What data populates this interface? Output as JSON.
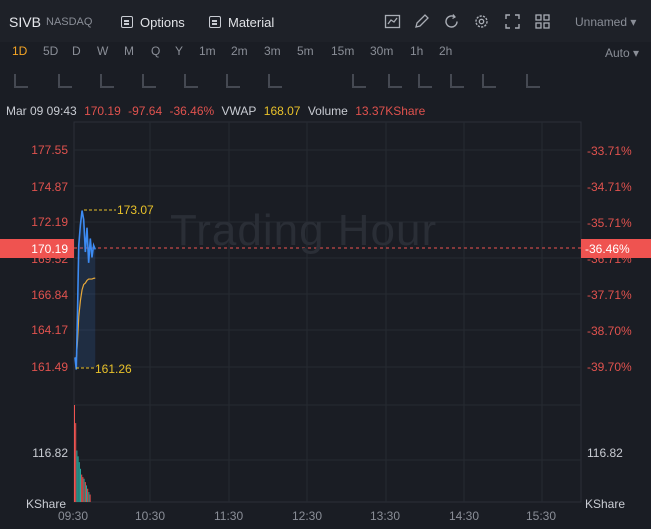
{
  "header": {
    "symbol": "SIVB",
    "exchange": "NASDAQ",
    "options_label": "Options",
    "material_label": "Material",
    "layout_label": "Unnamed ▾"
  },
  "timeframes": [
    "1D",
    "5D",
    "D",
    "W",
    "M",
    "Q",
    "Y",
    "1m",
    "2m",
    "3m",
    "5m",
    "15m",
    "30m",
    "1h",
    "2h"
  ],
  "active_timeframe": "1D",
  "auto_label": "Auto ▾",
  "info": {
    "datetime": "Mar 09 09:43",
    "price": "170.19",
    "change": "-97.64",
    "change_pct": "-36.46%",
    "vwap_label": "VWAP",
    "vwap": "168.07",
    "volume_label": "Volume",
    "volume": "13.37KShare"
  },
  "watermark": "Trading Hour",
  "current_price_tag": "170.19",
  "current_pct_tag": "-36.46%",
  "price_axis": [
    "177.55",
    "174.87",
    "172.19",
    "169.52",
    "166.84",
    "164.17",
    "161.49"
  ],
  "pct_axis": [
    "-33.71%",
    "-34.71%",
    "-35.71%",
    "-36.71%",
    "-37.71%",
    "-38.70%",
    "-39.70%"
  ],
  "volume_axis": {
    "value": "116.82",
    "unit": "KShare"
  },
  "time_axis": [
    "09:30",
    "10:30",
    "11:30",
    "12:30",
    "13:30",
    "14:30",
    "15:30"
  ],
  "high_label": "173.07",
  "low_label": "161.26",
  "colors": {
    "up": "#26a69a",
    "down": "#ef5350",
    "price_line": "#3d8bf2",
    "vwap_line": "#e8a93a",
    "accent": "#f5a524"
  },
  "chart_data": {
    "type": "line",
    "title": "",
    "x": [
      "09:30",
      "09:31",
      "09:32",
      "09:33",
      "09:34",
      "09:35",
      "09:36",
      "09:37",
      "09:38",
      "09:39",
      "09:40",
      "09:41",
      "09:42",
      "09:43"
    ],
    "series": [
      {
        "values": [
          162.2,
          161.3,
          165.5,
          170.5,
          172.0,
          173.07,
          172.4,
          170.0,
          171.8,
          169.2,
          171.0,
          169.6,
          170.5,
          170.19
        ]
      },
      {
        "values": [
          162.2,
          162.0,
          163.4,
          165.2,
          166.4,
          167.2,
          167.6,
          167.7,
          167.9,
          168.0,
          168.0,
          168.0,
          168.05,
          168.07
        ]
      }
    ],
    "volume": [
      116.8,
      95,
      62,
      55,
      48,
      40,
      33,
      30,
      28,
      24,
      20,
      16,
      12,
      9
    ],
    "volume_up": [
      false,
      false,
      true,
      true,
      true,
      true,
      false,
      false,
      true,
      false,
      true,
      false,
      true,
      false
    ],
    "ylim": [
      161.49,
      177.55
    ],
    "ylabel": "",
    "xlabel": ""
  }
}
